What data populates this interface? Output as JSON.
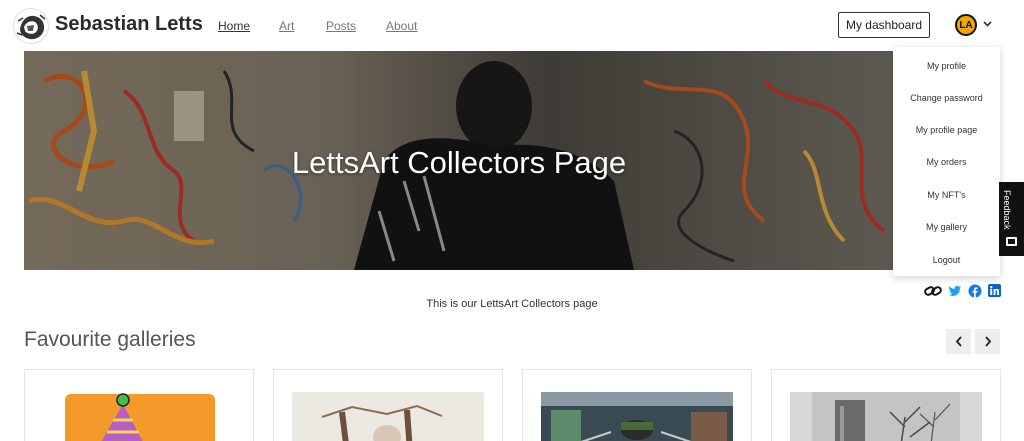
{
  "header": {
    "site_title": "Sebastian Letts",
    "nav": [
      {
        "label": "Home",
        "active": true
      },
      {
        "label": "Art",
        "active": false
      },
      {
        "label": "Posts",
        "active": false
      },
      {
        "label": "About",
        "active": false
      }
    ],
    "dashboard_label": "My dashboard",
    "avatar_initials": "LA",
    "avatar_color": "#f0a500"
  },
  "hero": {
    "title": "LettsArt Collectors Page"
  },
  "user_menu": {
    "items": [
      "My profile",
      "Change password",
      "My profile page",
      "My orders",
      "My NFT's",
      "My gallery",
      "Logout"
    ]
  },
  "feedback": {
    "label": "Feedback"
  },
  "share": {
    "icons": [
      "link-icon",
      "twitter-icon",
      "facebook-icon",
      "linkedin-icon"
    ],
    "twitter_color": "#1da1f2",
    "facebook_color": "#1877f2",
    "linkedin_color": "#0a66c2"
  },
  "page": {
    "caption": "This is our LettsArt Collectors page",
    "section_title": "Favourite galleries"
  },
  "carousel": {
    "prev_icon": "chevron-left-icon",
    "next_icon": "chevron-right-icon"
  }
}
